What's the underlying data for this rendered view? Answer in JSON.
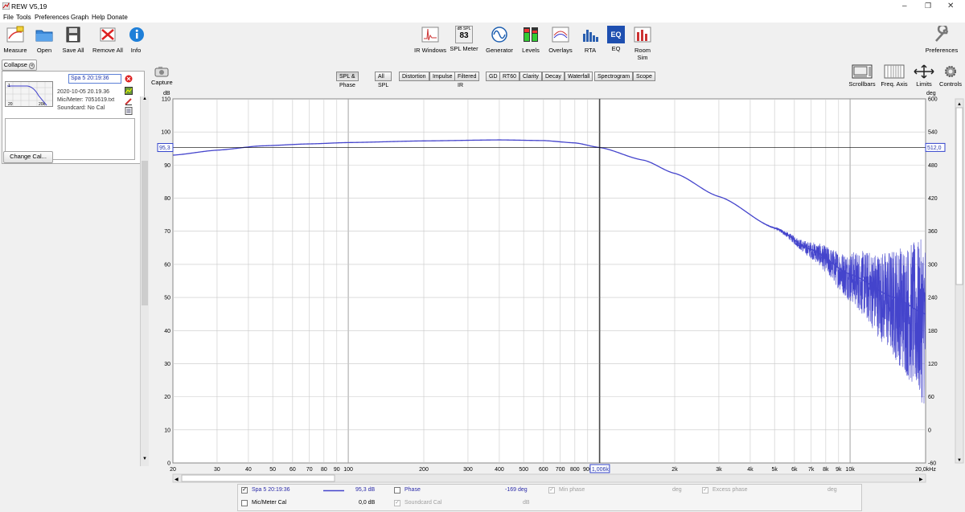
{
  "window": {
    "title": "REW V5,19"
  },
  "menu": [
    "File",
    "Tools",
    "Preferences",
    "Graph",
    "Help",
    "Donate"
  ],
  "toolbar_left": [
    {
      "label": "Measure",
      "icon": "measure-icon"
    },
    {
      "label": "Open",
      "icon": "folder-icon"
    },
    {
      "label": "Save All",
      "icon": "save-icon"
    },
    {
      "label": "Remove All",
      "icon": "remove-icon"
    },
    {
      "label": "Info",
      "icon": "info-icon"
    }
  ],
  "toolbar_center": [
    {
      "label": "IR Windows",
      "icon": "ir-windows-icon"
    },
    {
      "label": "SPL Meter",
      "icon": "spl-meter-icon",
      "badge_top": "dB SPL",
      "badge_value": "83"
    },
    {
      "label": "Generator",
      "icon": "generator-icon"
    },
    {
      "label": "Levels",
      "icon": "levels-icon"
    },
    {
      "label": "Overlays",
      "icon": "overlays-icon"
    },
    {
      "label": "RTA",
      "icon": "rta-icon"
    },
    {
      "label": "EQ",
      "icon": "eq-icon",
      "badge_value": "EQ"
    },
    {
      "label": "Room Sim",
      "icon": "room-sim-icon"
    }
  ],
  "toolbar_right": {
    "label": "Preferences",
    "icon": "wrench-icon"
  },
  "panel": {
    "collapse_label": "Collapse",
    "measurement_name": "Spa 5 20:19:36",
    "date": "2020-10-05 20.19.36",
    "mic": "Mic/Meter: 7051619.txt",
    "soundcard": "Soundcard: No Cal",
    "thumb_labels": [
      "1",
      "20",
      "20k"
    ],
    "change_cal": "Change Cal..."
  },
  "capture_label": "Capture",
  "graph_tabs": [
    "SPL & Phase",
    "All SPL",
    "Distortion",
    "Impulse",
    "Filtered IR",
    "GD",
    "RT60",
    "Clarity",
    "Decay",
    "Waterfall",
    "Spectrogram",
    "Scope"
  ],
  "graph_tools": [
    "Scrollbars",
    "Freq. Axis",
    "Limits",
    "Controls"
  ],
  "cursor": {
    "y_value": "95,3",
    "freq": "1,006k",
    "phase_value": "512,0"
  },
  "colors": {
    "trace": "#4444cc",
    "cursor": "#000000",
    "grid": "#c8c8c8"
  },
  "chart_data": {
    "type": "line",
    "xscale": "log",
    "xlim": [
      20,
      20000
    ],
    "ylim": [
      0,
      110
    ],
    "ylim_right": [
      -60,
      600
    ],
    "ylabel": "dB",
    "ylabel_right": "deg",
    "x_ticks": [
      "20",
      "30",
      "40",
      "50",
      "60",
      "70",
      "80",
      "90",
      "100",
      "200",
      "300",
      "400",
      "500",
      "600",
      "700",
      "800",
      "900",
      "2k",
      "3k",
      "4k",
      "5k",
      "6k",
      "7k",
      "8k",
      "9k",
      "10k",
      "20,0kHz"
    ],
    "y_ticks": [
      "0",
      "10",
      "20",
      "30",
      "40",
      "50",
      "60",
      "70",
      "80",
      "90",
      "100",
      "110"
    ],
    "y_ticks_right": [
      "-60",
      "0",
      "60",
      "120",
      "180",
      "240",
      "300",
      "360",
      "420",
      "480",
      "540",
      "600"
    ],
    "series": [
      {
        "name": "Spa 5 20:19:36",
        "x": [
          20,
          30,
          45,
          70,
          100,
          200,
          400,
          600,
          800,
          1006,
          1500,
          2000,
          3000,
          5000,
          7000,
          10000,
          15000,
          20000
        ],
        "y": [
          93,
          94.5,
          95.8,
          96.4,
          96.8,
          97.3,
          97.6,
          97.4,
          96.7,
          95.3,
          91.5,
          87.5,
          80.5,
          71,
          64.5,
          57,
          50,
          45
        ]
      }
    ]
  },
  "legend": {
    "row1": {
      "name": "Spa 5 20:19:36",
      "value": "95,3 dB",
      "phase": "Phase",
      "phase_value": "-169 deg",
      "minphase": "Min phase",
      "minphase_unit": "deg",
      "excess": "Excess phase",
      "excess_unit": "deg"
    },
    "row2": {
      "name": "Mic/Meter Cal",
      "value": "0,0 dB",
      "soundcard": "Soundcard Cal",
      "soundcard_unit": "dB"
    }
  }
}
